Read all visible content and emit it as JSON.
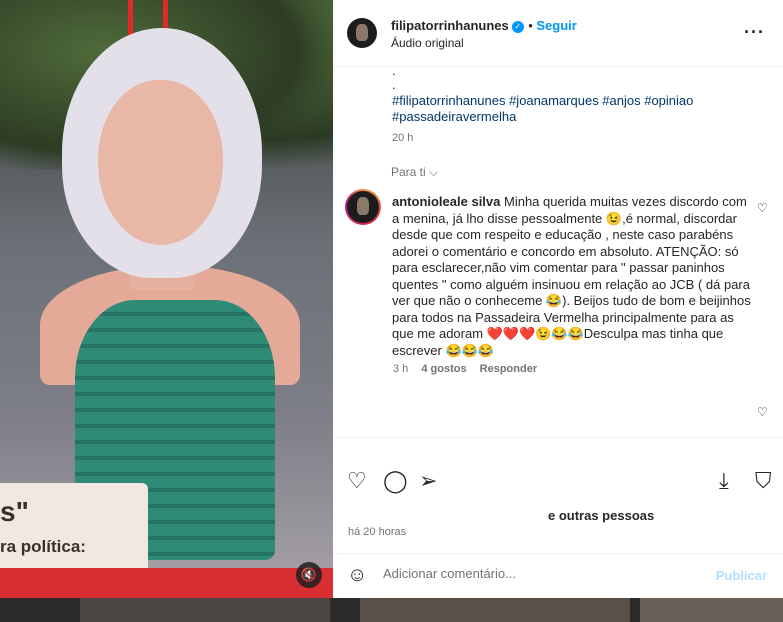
{
  "post": {
    "username": "filipatorrinhanunes",
    "follow_label": "Seguir",
    "audio": "Áudio original",
    "more_label": "···",
    "caption_dots": [
      ".",
      "."
    ],
    "hashtags": "#filipatorrinhanunes #joanamarques #anjos #opiniao #passadeiravermelha",
    "caption_time": "20 h",
    "sort_label": "Para ti ⌵"
  },
  "media": {
    "card_quote": "s\"",
    "card_text": "ra política:",
    "mute_icon": "🔇"
  },
  "comment": {
    "username": "antonioleale silva",
    "username_exact": "antonioleale silva",
    "text": "Minha querida muitas vezes discordo com a menina, já lho disse pessoalmente 😉,é normal, discordar desde que com respeito e educação , neste caso parabéns adorei o comentário e concordo em absoluto. ATENÇÃO: só para esclarecer,não vim comentar para \" passar paninhos quentes \" como alguém insinuou em relação ao JCB ( dá para ver que não o conheceme 😂). Beijos tudo de bom e beijinhos para todos na Passadeira Vermelha principalmente para as que me adoram ❤️❤️❤️😉😂😂Desculpa mas tinha que escrever 😂😂😂",
    "time": "3 h",
    "likes": "4 gostos",
    "reply": "Responder"
  },
  "actions": {
    "likes_text": "e outras pessoas",
    "posted": "há 20 horas"
  },
  "composer": {
    "placeholder": "Adicionar comentário...",
    "publish": "Publicar"
  },
  "colors": {
    "accent": "#0095f6",
    "muted": "#737373"
  }
}
